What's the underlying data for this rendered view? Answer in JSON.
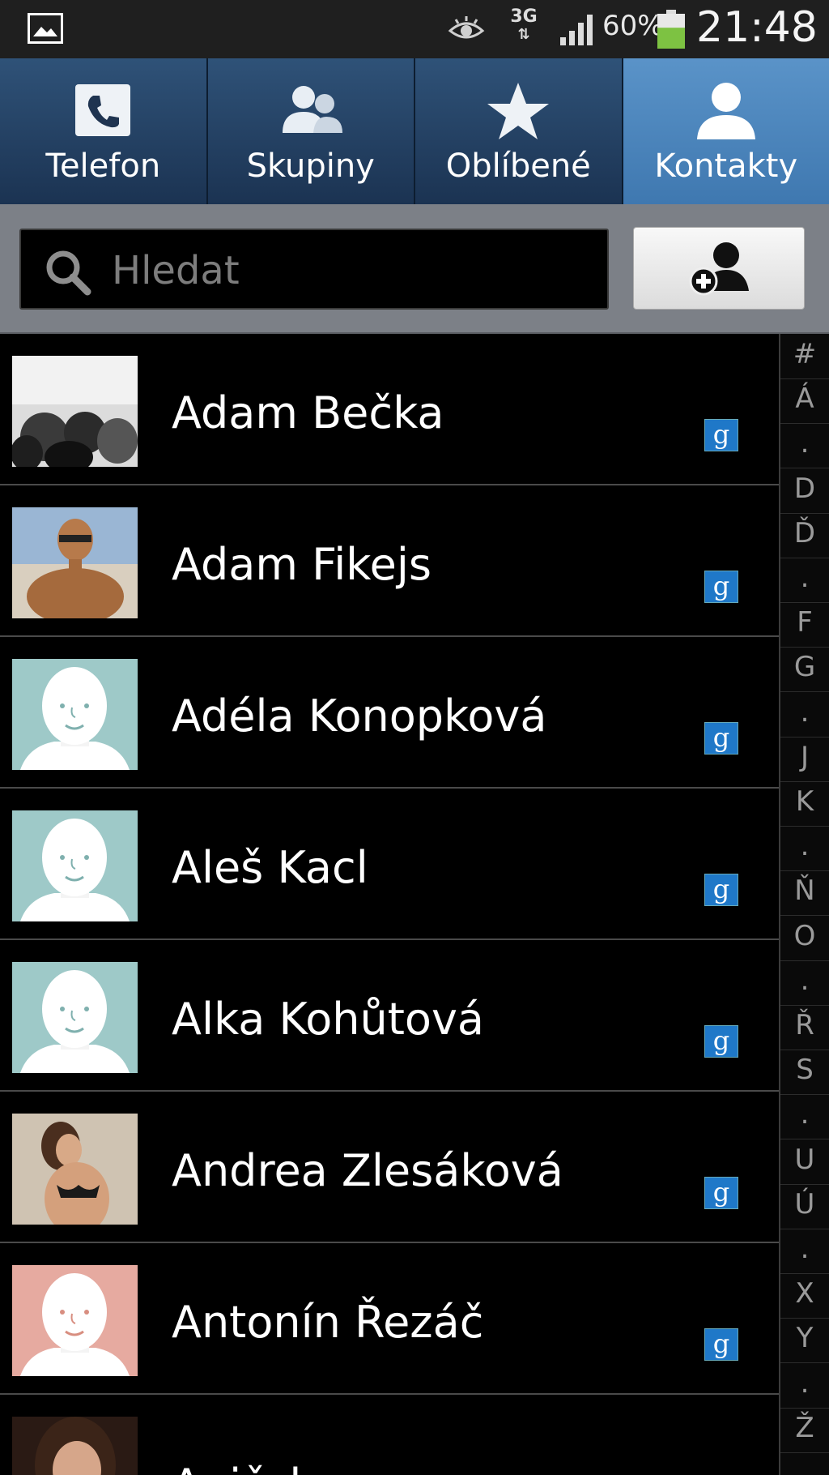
{
  "status_bar": {
    "network": "3G",
    "battery_percent": "60%",
    "battery_level": 0.6,
    "time": "21:48"
  },
  "tabs": [
    {
      "label": "Telefon",
      "icon": "phone-icon",
      "active": false
    },
    {
      "label": "Skupiny",
      "icon": "groups-icon",
      "active": false
    },
    {
      "label": "Oblíbené",
      "icon": "star-icon",
      "active": false
    },
    {
      "label": "Kontakty",
      "icon": "contact-icon",
      "active": true
    }
  ],
  "search": {
    "placeholder": "Hledat",
    "value": ""
  },
  "contacts": [
    {
      "name": "Adam Bečka",
      "photo": "photo-crowd",
      "account": "g"
    },
    {
      "name": "Adam Fikejs",
      "photo": "photo-man",
      "account": "g"
    },
    {
      "name": "Adéla Konopková",
      "photo": "default-avatar-teal",
      "account": "g"
    },
    {
      "name": "Aleš Kacl",
      "photo": "default-avatar-teal",
      "account": "g"
    },
    {
      "name": "Alka Kohůtová",
      "photo": "default-avatar-teal",
      "account": "g"
    },
    {
      "name": "Andrea Zlesáková",
      "photo": "photo-woman",
      "account": "g"
    },
    {
      "name": "Antonín Řezáč",
      "photo": "default-avatar-pink",
      "account": "g"
    },
    {
      "name": "Aničcka...",
      "photo": "photo-woman-2",
      "account": ""
    }
  ],
  "index_letters": [
    "#",
    "Á",
    ".",
    "D",
    "Ď",
    ".",
    "F",
    "G",
    ".",
    "J",
    "K",
    ".",
    "Ň",
    "O",
    ".",
    "Ř",
    "S",
    ".",
    "U",
    "Ú",
    ".",
    "X",
    "Y",
    ".",
    "Ž"
  ],
  "colors": {
    "tab_active": "#4a86be",
    "tab_inactive": "#24426a",
    "google_badge": "#1f78c8",
    "battery": "#7dc242"
  }
}
